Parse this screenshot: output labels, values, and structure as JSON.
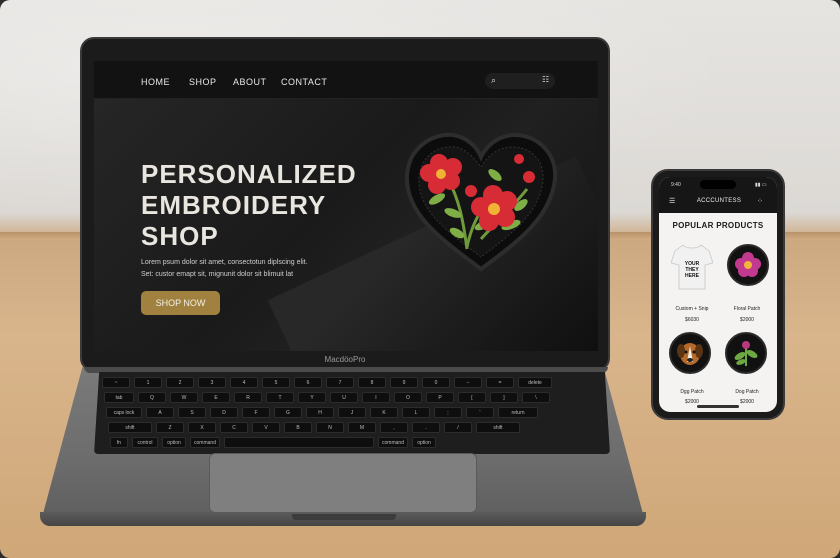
{
  "laptop": {
    "nav": {
      "items": [
        "HOME",
        "SHOP",
        "ABOUT",
        "CONTACT"
      ]
    },
    "hero": {
      "title_lines": [
        "PERSONALIZED",
        "EMBROIDERY",
        "SHOP"
      ],
      "text_lines": [
        "Lorem psum dolor sit amet, consectotun diplscing elit.",
        "Set: custor emapt sit, mignunit dolor sit blimuit lat"
      ],
      "cta_label": "SHOP NOW"
    },
    "brand": "MacdöoPro",
    "keys": {
      "row1": [
        "~",
        "1",
        "2",
        "3",
        "4",
        "5",
        "6",
        "7",
        "8",
        "9",
        "0",
        "−",
        "=",
        "delete"
      ],
      "row2": [
        "tab",
        "Q",
        "W",
        "E",
        "R",
        "T",
        "Y",
        "U",
        "I",
        "O",
        "P",
        "[",
        "]",
        "\\"
      ],
      "row3": [
        "caps lock",
        "A",
        "S",
        "D",
        "F",
        "G",
        "H",
        "J",
        "K",
        "L",
        ";",
        "'",
        "return"
      ],
      "row4": [
        "shift",
        "Z",
        "X",
        "C",
        "V",
        "B",
        "N",
        "M",
        ",",
        ".",
        "/",
        "shift"
      ],
      "row5": [
        "fn",
        "control",
        "option",
        "command",
        "",
        "command",
        "option"
      ]
    }
  },
  "phone": {
    "status_time": "9:40",
    "header_title": "ACCCUNTESS",
    "section_title": "POPULAR PRODUCTS",
    "products": [
      {
        "name": "Custom + Snip",
        "price": "$6030",
        "img_text": "YOUR THEY HERE"
      },
      {
        "name": "Floral Patch",
        "price": "$2000"
      },
      {
        "name": "Dgg Patch",
        "price": "$2000"
      },
      {
        "name": "Dog Patch",
        "price": "$2000"
      }
    ]
  }
}
